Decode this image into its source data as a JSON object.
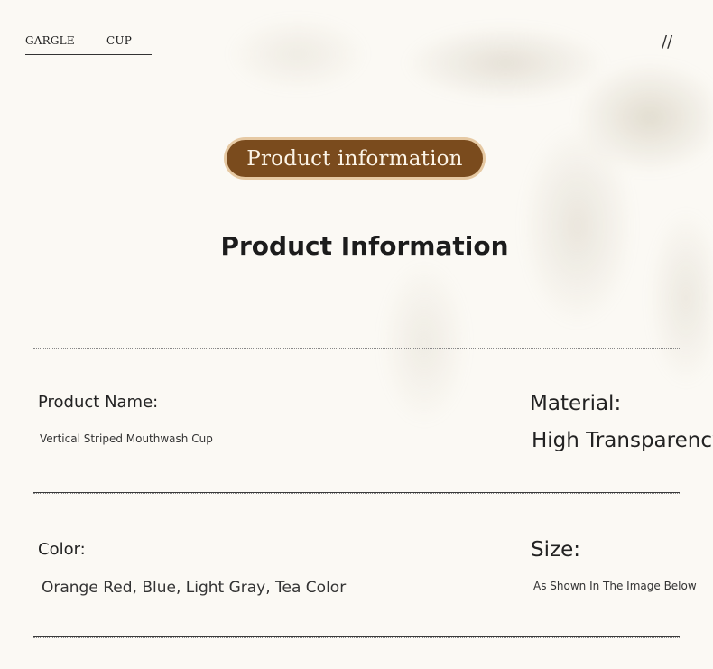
{
  "nav": {
    "left": "GARGLE",
    "right": "CUP",
    "mark": "//"
  },
  "banner": {
    "label": "Product information"
  },
  "title": "Product Information",
  "fields": {
    "name_label": "Product Name:",
    "name_value": "Vertical Striped Mouthwash Cup",
    "material_label": "Material:",
    "material_value": "High Transparency",
    "color_label": "Color:",
    "color_value": "Orange Red, Blue, Light Gray, Tea Color",
    "size_label": "Size:",
    "size_value": "As Shown In The Image Below"
  },
  "colors": {
    "background": "#fbf9f4",
    "banner_fill": "#7a4b1d",
    "banner_border": "#e6c9a3",
    "banner_text": "#fbf3e6"
  }
}
